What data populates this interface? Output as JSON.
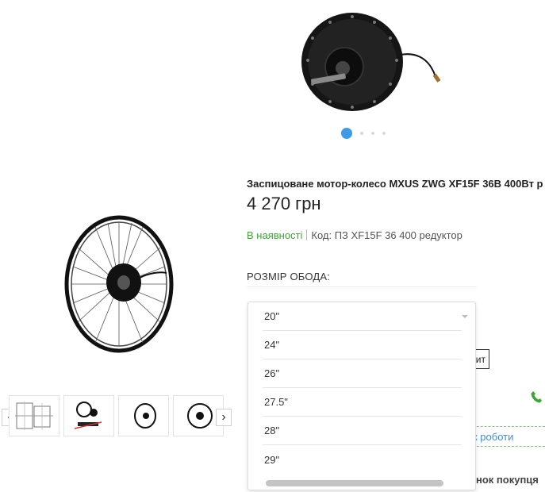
{
  "product": {
    "title": "Заспицоване мотор-колесо MXUS ZWG XF15F 36В 400Вт р",
    "price": "4 270 грн",
    "availability": "В наявності",
    "code": "Код: ПЗ XF15F 36 400 редуктор"
  },
  "options": {
    "rim_label": "РОЗМІР ОБОДА:",
    "rim_sizes": [
      "20\"",
      "24\"",
      "26\"",
      "27.5\"",
      "28\"",
      "29\""
    ]
  },
  "behind": {
    "button_partial": "ит",
    "link_partial": "к роботи",
    "bottom_partial": "нок покупця"
  },
  "gallery": {
    "prev_arrow": "‹",
    "next_arrow": "›",
    "slide_count": 4,
    "active_slide": 1
  },
  "colors": {
    "accent_blue": "#3d9be9",
    "in_stock_green": "#3aa832",
    "link_blue": "#3d8de0"
  }
}
